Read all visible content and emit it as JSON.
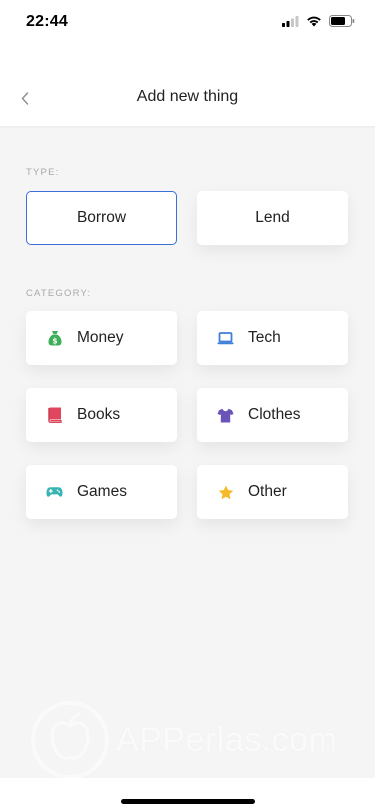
{
  "status_bar": {
    "time": "22:44"
  },
  "nav": {
    "title": "Add new thing"
  },
  "type_section": {
    "label": "TYPE:",
    "options": [
      {
        "label": "Borrow",
        "selected": true
      },
      {
        "label": "Lend",
        "selected": false
      }
    ]
  },
  "category_section": {
    "label": "CATEGORY:",
    "items": [
      {
        "label": "Money",
        "icon": "money-bag-icon",
        "color": "#3fae5a"
      },
      {
        "label": "Tech",
        "icon": "laptop-icon",
        "color": "#3d7fd9"
      },
      {
        "label": "Books",
        "icon": "book-icon",
        "color": "#e0475f"
      },
      {
        "label": "Clothes",
        "icon": "tshirt-icon",
        "color": "#6b53b8"
      },
      {
        "label": "Games",
        "icon": "gamepad-icon",
        "color": "#37b3b3"
      },
      {
        "label": "Other",
        "icon": "star-icon",
        "color": "#f5b92a"
      }
    ]
  },
  "watermark": {
    "text": "APPerlas.com"
  },
  "colors": {
    "accent": "#3a6fd8",
    "background": "#f5f5f5"
  }
}
